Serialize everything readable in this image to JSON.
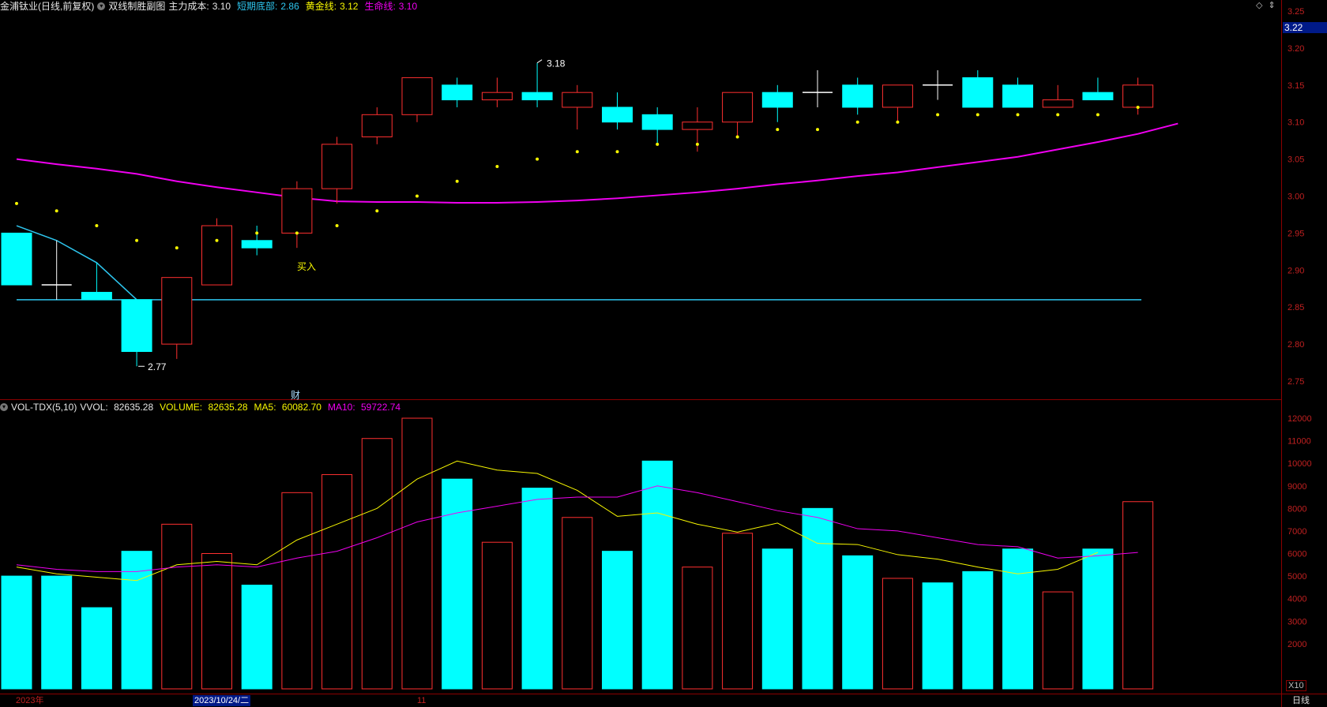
{
  "header": {
    "stock_name": "金浦钛业(日线,前复权)",
    "indicator_name": "双线制胜副图",
    "main_cost_label": "主力成本:",
    "main_cost_value": "3.10",
    "short_bottom_label": "短期底部:",
    "short_bottom_value": "2.86",
    "golden_line_label": "黄金线:",
    "golden_line_value": "3.12",
    "life_line_label": "生命线:",
    "life_line_value": "3.10"
  },
  "corner_icons": "◇ ⇕",
  "current_price_tag": "3.22",
  "price_axis": [
    "3.25",
    "3.20",
    "3.15",
    "3.10",
    "3.05",
    "3.00",
    "2.95",
    "2.90",
    "2.85",
    "2.80",
    "2.75"
  ],
  "annotations": {
    "high": "3.18",
    "low": "2.77",
    "buy": "买入",
    "fin": "财"
  },
  "volume_header": {
    "indicator": "VOL-TDX(5,10)",
    "vvol_label": "VVOL:",
    "vvol_value": "82635.28",
    "volume_label": "VOLUME:",
    "volume_value": "82635.28",
    "ma5_label": "MA5:",
    "ma5_value": "60082.70",
    "ma10_label": "MA10:",
    "ma10_value": "59722.74"
  },
  "volume_axis": [
    "12000",
    "11000",
    "10000",
    "9000",
    "8000",
    "7000",
    "6000",
    "5000",
    "4000",
    "3000",
    "2000"
  ],
  "multiplier": "X10",
  "footer": {
    "year": "2023年",
    "date": "2023/10/24/二",
    "month": "11",
    "period": "日线"
  },
  "colors": {
    "up": "#ff3030",
    "down": "#00ffff",
    "ma5": "#f7f700",
    "ma10": "#f000f0",
    "life": "#f000f0",
    "support": "#2ec7f0"
  },
  "chart_data": {
    "type": "candlestick",
    "price_range": [
      2.73,
      3.26
    ],
    "volume_range": [
      0,
      12500
    ],
    "candles": [
      {
        "o": 2.95,
        "h": 2.95,
        "l": 2.88,
        "c": 2.88,
        "v": 5000,
        "sar": 2.99
      },
      {
        "o": 2.88,
        "h": 2.94,
        "l": 2.86,
        "c": 2.88,
        "v": 5000,
        "sar": 2.98
      },
      {
        "o": 2.87,
        "h": 2.91,
        "l": 2.86,
        "c": 2.86,
        "v": 3600,
        "sar": 2.96
      },
      {
        "o": 2.86,
        "h": 2.86,
        "l": 2.77,
        "c": 2.79,
        "v": 6100,
        "sar": 2.94
      },
      {
        "o": 2.8,
        "h": 2.89,
        "l": 2.78,
        "c": 2.89,
        "v": 7300,
        "sar": 2.93
      },
      {
        "o": 2.88,
        "h": 2.97,
        "l": 2.88,
        "c": 2.96,
        "v": 6000,
        "sar": 2.94
      },
      {
        "o": 2.94,
        "h": 2.96,
        "l": 2.92,
        "c": 2.93,
        "v": 4600,
        "sar": 2.95
      },
      {
        "o": 2.95,
        "h": 3.02,
        "l": 2.93,
        "c": 3.01,
        "v": 8700,
        "sar": 2.95
      },
      {
        "o": 3.01,
        "h": 3.08,
        "l": 2.99,
        "c": 3.07,
        "v": 9500,
        "sar": 2.96
      },
      {
        "o": 3.08,
        "h": 3.12,
        "l": 3.07,
        "c": 3.11,
        "v": 11100,
        "sar": 2.98
      },
      {
        "o": 3.11,
        "h": 3.16,
        "l": 3.1,
        "c": 3.16,
        "v": 12000,
        "sar": 3.0
      },
      {
        "o": 3.15,
        "h": 3.16,
        "l": 3.12,
        "c": 3.13,
        "v": 9300,
        "sar": 3.02
      },
      {
        "o": 3.13,
        "h": 3.16,
        "l": 3.12,
        "c": 3.14,
        "v": 6500,
        "sar": 3.04
      },
      {
        "o": 3.14,
        "h": 3.18,
        "l": 3.12,
        "c": 3.13,
        "v": 8900,
        "sar": 3.05
      },
      {
        "o": 3.12,
        "h": 3.15,
        "l": 3.09,
        "c": 3.14,
        "v": 7600,
        "sar": 3.06
      },
      {
        "o": 3.12,
        "h": 3.14,
        "l": 3.09,
        "c": 3.1,
        "v": 6100,
        "sar": 3.06
      },
      {
        "o": 3.11,
        "h": 3.12,
        "l": 3.07,
        "c": 3.09,
        "v": 10100,
        "sar": 3.07
      },
      {
        "o": 3.09,
        "h": 3.12,
        "l": 3.06,
        "c": 3.1,
        "v": 5400,
        "sar": 3.07
      },
      {
        "o": 3.1,
        "h": 3.14,
        "l": 3.08,
        "c": 3.14,
        "v": 6900,
        "sar": 3.08
      },
      {
        "o": 3.14,
        "h": 3.15,
        "l": 3.1,
        "c": 3.12,
        "v": 6200,
        "sar": 3.09
      },
      {
        "o": 3.14,
        "h": 3.17,
        "l": 3.12,
        "c": 3.14,
        "v": 8000,
        "sar": 3.09
      },
      {
        "o": 3.15,
        "h": 3.16,
        "l": 3.11,
        "c": 3.12,
        "v": 5900,
        "sar": 3.1
      },
      {
        "o": 3.12,
        "h": 3.15,
        "l": 3.1,
        "c": 3.15,
        "v": 4900,
        "sar": 3.1
      },
      {
        "o": 3.15,
        "h": 3.17,
        "l": 3.13,
        "c": 3.15,
        "v": 4700,
        "sar": 3.11
      },
      {
        "o": 3.16,
        "h": 3.17,
        "l": 3.12,
        "c": 3.12,
        "v": 5200,
        "sar": 3.11
      },
      {
        "o": 3.15,
        "h": 3.16,
        "l": 3.12,
        "c": 3.12,
        "v": 6200,
        "sar": 3.11
      },
      {
        "o": 3.12,
        "h": 3.15,
        "l": 3.12,
        "c": 3.13,
        "v": 4300,
        "sar": 3.11
      },
      {
        "o": 3.14,
        "h": 3.16,
        "l": 3.13,
        "c": 3.13,
        "v": 6200,
        "sar": 3.11
      },
      {
        "o": 3.12,
        "h": 3.16,
        "l": 3.11,
        "c": 3.15,
        "v": 8300,
        "sar": 3.12
      }
    ],
    "life_line": [
      3.05,
      3.043,
      3.037,
      3.03,
      3.02,
      3.012,
      3.005,
      2.998,
      2.993,
      2.992,
      2.992,
      2.991,
      2.991,
      2.992,
      2.994,
      2.997,
      3.001,
      3.005,
      3.01,
      3.016,
      3.021,
      3.027,
      3.032,
      3.039,
      3.046,
      3.053,
      3.063,
      3.073,
      3.084,
      3.098
    ],
    "short_line": [
      2.96,
      2.94,
      2.91,
      2.86
    ],
    "support_level": 2.86,
    "ma5": [
      5400,
      5100,
      4950,
      4800,
      5500,
      5650,
      5500,
      6600,
      7300,
      8000,
      9300,
      10100,
      9700,
      9550,
      8800,
      7650,
      7800,
      7300,
      6950,
      7350,
      6450,
      6400,
      5950,
      5750,
      5400,
      5100,
      5300,
      6050
    ],
    "ma10": [
      5500,
      5300,
      5200,
      5200,
      5400,
      5500,
      5400,
      5800,
      6100,
      6700,
      7400,
      7800,
      8100,
      8400,
      8500,
      8500,
      9000,
      8700,
      8300,
      7900,
      7600,
      7100,
      7000,
      6700,
      6400,
      6300,
      5800,
      5900,
      6050
    ]
  }
}
